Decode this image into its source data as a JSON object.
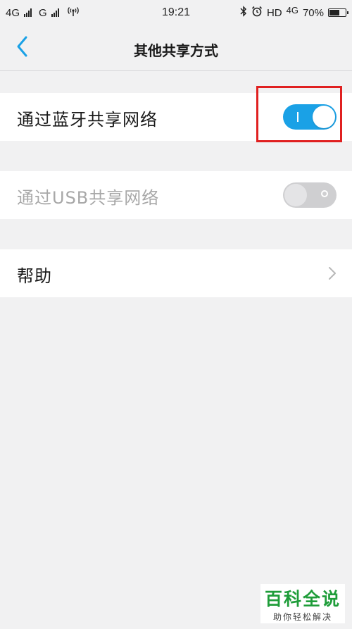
{
  "status_bar": {
    "network1": "4G",
    "network2": "G",
    "time": "19:21",
    "hd": "HD",
    "network3": "4G",
    "battery": "70%",
    "battery_level": 0.7
  },
  "header": {
    "title": "其他共享方式"
  },
  "settings": {
    "bluetooth_label": "通过蓝牙共享网络",
    "bluetooth_on": true,
    "usb_label": "通过USB共享网络",
    "usb_on": false,
    "help_label": "帮助"
  },
  "colors": {
    "accent": "#1aa1e6",
    "highlight": "#e02020",
    "watermark_green": "#1f9d3a"
  },
  "watermark": {
    "title": "百科全说",
    "subtitle": "助你轻松解决"
  }
}
